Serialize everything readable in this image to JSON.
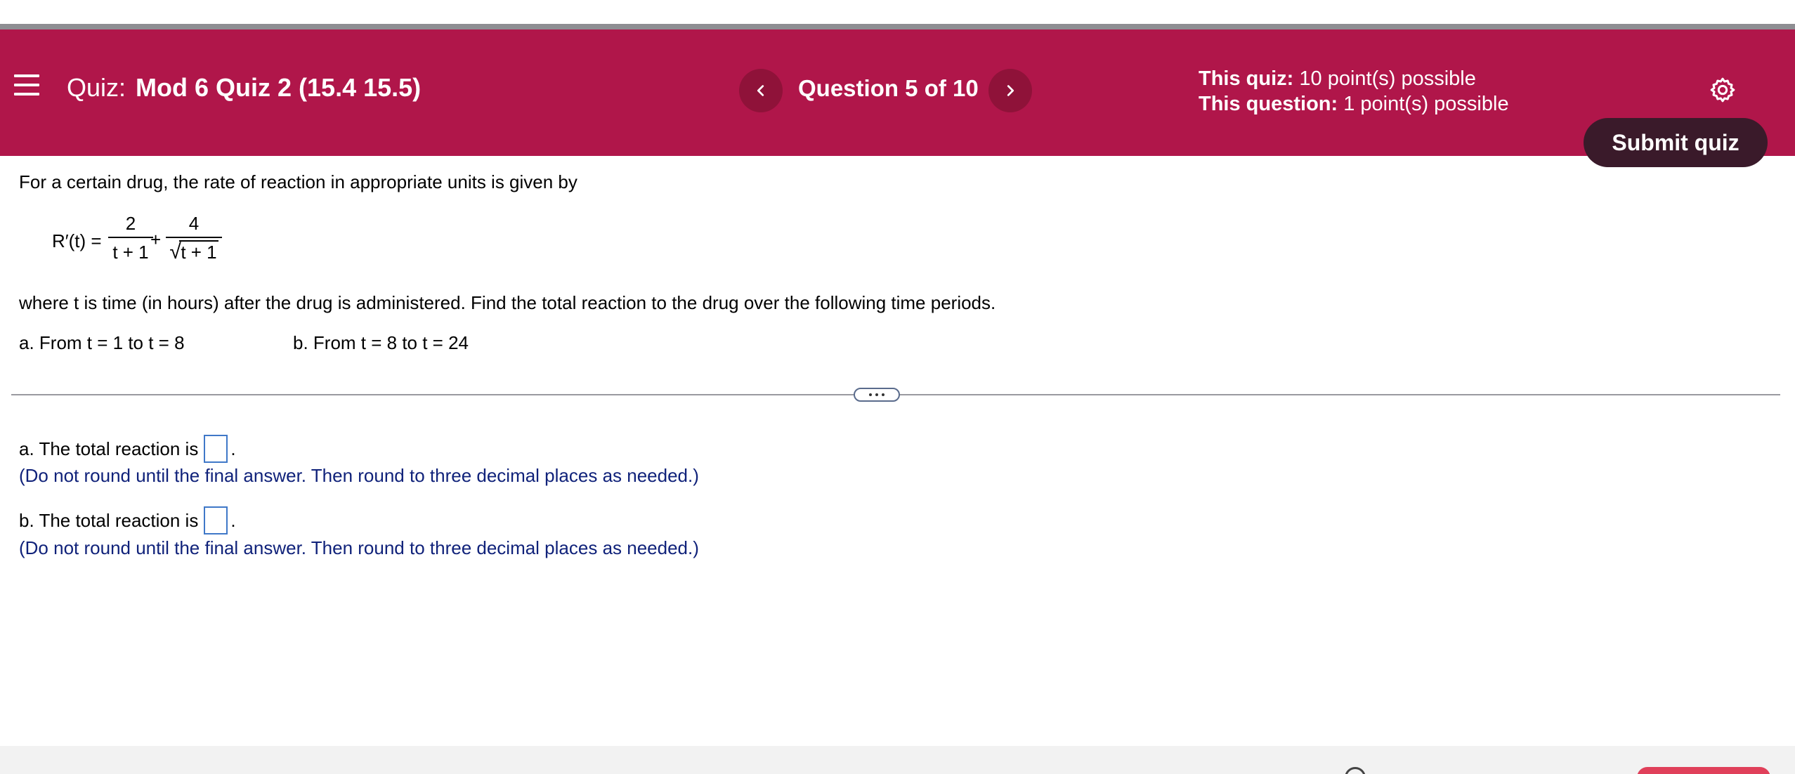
{
  "header": {
    "quiz_prefix": "Quiz:",
    "quiz_name": "Mod 6 Quiz 2 (15.4 15.5)",
    "question_label": "Question 5 of 10",
    "this_quiz_label": "This quiz:",
    "this_quiz_value": "10 point(s) possible",
    "this_question_label": "This question:",
    "this_question_value": "1 point(s) possible",
    "submit_label": "Submit quiz",
    "prev_glyph": "‹",
    "next_glyph": "›"
  },
  "problem": {
    "intro": "For a certain drug, the rate of reaction in appropriate units is given by",
    "formula": {
      "lhs": "R′(t) =",
      "frac1_num": "2",
      "frac1_den": "t + 1",
      "plus": "+",
      "frac2_num": "4",
      "frac2_den": "t + 1"
    },
    "where": "where t is time (in hours) after the drug is administered.  Find the total reaction to the drug over the following time periods.",
    "part_a": "a.  From t = 1 to t = 8",
    "part_b": "b.  From t = 8 to t = 24"
  },
  "answers": {
    "a_label": "a. The total reaction is",
    "a_hint": "(Do not round until the final answer.  Then round to three decimal places as needed.)",
    "b_label": "b. The total reaction is",
    "b_hint": "(Do not round until the final answer.  Then round to three decimal places as needed.)",
    "period": "."
  },
  "colors": {
    "header_bg": "#b0164a",
    "nav_btn_bg": "#8f1239",
    "submit_bg": "#3a1a2a",
    "hint_text": "#10227a",
    "answer_box_border": "#3f78c8"
  },
  "icons": [
    "menu-icon",
    "chevron-left-icon",
    "chevron-right-icon",
    "gear-icon",
    "ellipsis-icon"
  ]
}
